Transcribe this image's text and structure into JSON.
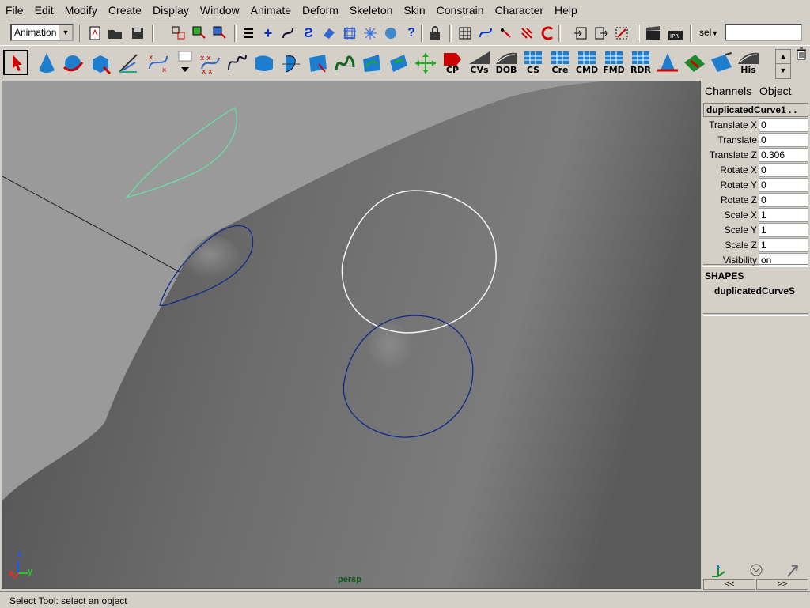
{
  "menubar": {
    "items": [
      "File",
      "Edit",
      "Modify",
      "Create",
      "Display",
      "Window",
      "Animate",
      "Deform",
      "Skeleton",
      "Skin",
      "Constrain",
      "Character",
      "Help"
    ]
  },
  "statusline": {
    "mode": "Animation",
    "sel_label": "sel",
    "sel_value": "",
    "icons": [
      "new-scene-icon",
      "open-scene-icon",
      "save-scene-icon",
      "select-hierarchy-icon",
      "select-object-icon",
      "select-component-icon",
      "menu-icon",
      "plus-icon",
      "snap-curve-icon",
      "snap-grid-icon",
      "snap-point-icon",
      "snap-plane-icon",
      "snap-view-icon",
      "history-icon",
      "help-icon",
      "lock-icon",
      "construction-history-icon",
      "curve-tool-icon",
      "input-output-icon",
      "magnet-icon",
      "render-icon",
      "ipr-render-icon"
    ]
  },
  "shelf": {
    "labels": {
      "cp": "CP",
      "cvs": "CVs",
      "dob": "DOB",
      "cs": "CS",
      "cre": "Cre",
      "cmd": "CMD",
      "fmd": "FMD",
      "rdr": "RDR",
      "his": "His"
    }
  },
  "viewport": {
    "camera": "persp",
    "axis": {
      "x": "x",
      "y": "y",
      "z": "z"
    }
  },
  "channel_box": {
    "tabs": [
      "Channels",
      "Object"
    ],
    "node": "duplicatedCurve1 . .",
    "attributes": [
      {
        "label": "Translate X",
        "value": "0"
      },
      {
        "label": "Translate",
        "value": "0"
      },
      {
        "label": "Translate Z",
        "value": "0.306"
      },
      {
        "label": "Rotate X",
        "value": "0"
      },
      {
        "label": "Rotate Y",
        "value": "0"
      },
      {
        "label": "Rotate Z",
        "value": "0"
      },
      {
        "label": "Scale X",
        "value": "1"
      },
      {
        "label": "Scale Y",
        "value": "1"
      },
      {
        "label": "Scale Z",
        "value": "1"
      },
      {
        "label": "Visibility",
        "value": "on"
      }
    ],
    "shapes_heading": "SHAPES",
    "shape": "duplicatedCurveS",
    "nav_prev": "<<",
    "nav_next": ">>"
  },
  "helpline": "Select Tool: select an object"
}
